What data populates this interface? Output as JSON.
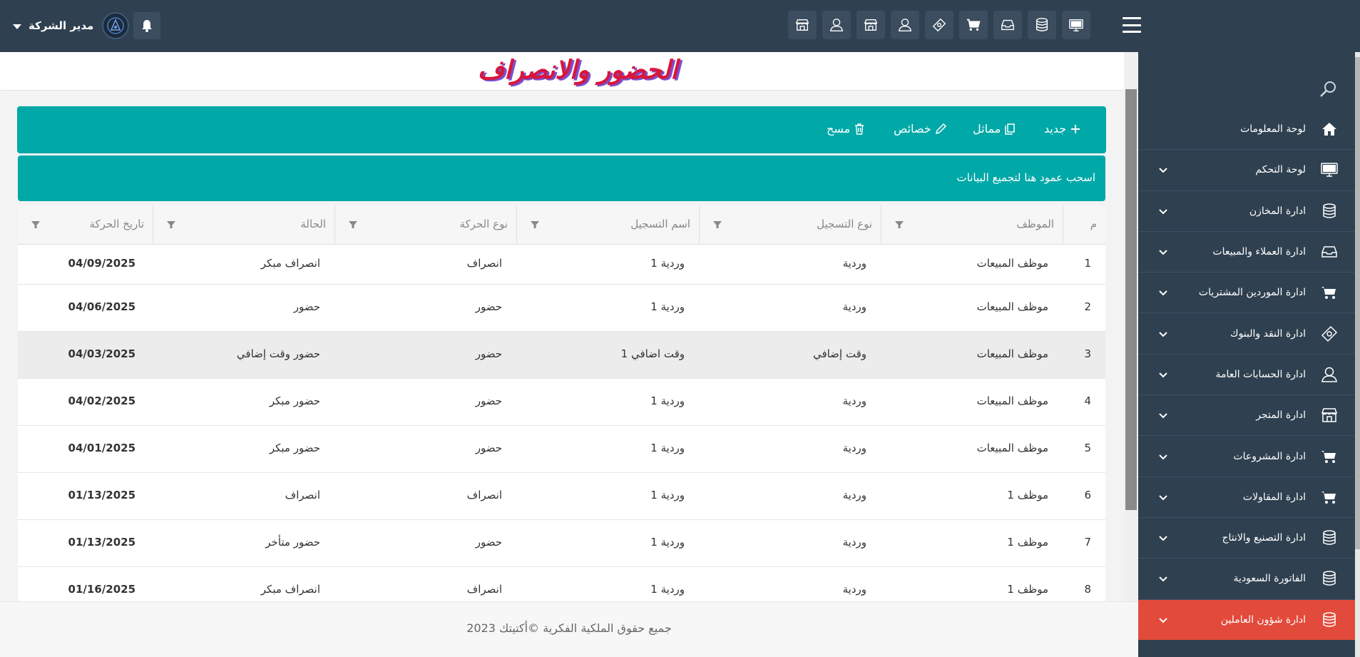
{
  "header": {
    "user_name": "مدير الشركة",
    "top_icons": [
      "store-icon",
      "user-icon",
      "store-icon",
      "user-icon",
      "money-icon",
      "cart-icon",
      "inbox-icon",
      "database-icon",
      "monitor-icon"
    ]
  },
  "page": {
    "title": "الحضور والانصراف"
  },
  "toolbar": {
    "new_label": "جديد",
    "similar_label": "مماثل",
    "properties_label": "خصائص",
    "delete_label": "مسح"
  },
  "grouping": {
    "hint": "اسحب عمود هنا لتجميع البيانات"
  },
  "table": {
    "columns": [
      "م",
      "الموظف",
      "نوع التسجيل",
      "اسم التسجيل",
      "نوع الحركة",
      "الحالة",
      "تاريخ الحركة"
    ],
    "rows": [
      [
        "1",
        "موظف المبيعات",
        "وردية",
        "وردية 1",
        "انصراف",
        "انصراف مبكر",
        "04/09/2025"
      ],
      [
        "2",
        "موظف المبيعات",
        "وردية",
        "وردية 1",
        "حضور",
        "حضور",
        "04/06/2025"
      ],
      [
        "3",
        "موظف المبيعات",
        "وقت إضافي",
        "وقت اضافي 1",
        "حضور",
        "حضور وقت إضافي",
        "04/03/2025"
      ],
      [
        "4",
        "موظف المبيعات",
        "وردية",
        "وردية 1",
        "حضور",
        "حضور مبكر",
        "04/02/2025"
      ],
      [
        "5",
        "موظف المبيعات",
        "وردية",
        "وردية 1",
        "حضور",
        "حضور مبكر",
        "04/01/2025"
      ],
      [
        "6",
        "موظف 1",
        "وردية",
        "وردية 1",
        "انصراف",
        "انصراف",
        "01/13/2025"
      ],
      [
        "7",
        "موظف 1",
        "وردية",
        "وردية 1",
        "حضور",
        "حضور متأخر",
        "01/13/2025"
      ],
      [
        "8",
        "موظف 1",
        "وردية",
        "وردية 1",
        "انصراف",
        "انصراف مبكر",
        "01/16/2025"
      ]
    ]
  },
  "sidebar": {
    "items": [
      {
        "label": "لوحة المعلومات",
        "icon": "home-icon"
      },
      {
        "label": "لوحة التحكم",
        "icon": "monitor-icon"
      },
      {
        "label": "ادارة المخازن",
        "icon": "database-icon"
      },
      {
        "label": "ادارة العملاء والمبيعات",
        "icon": "inbox-icon"
      },
      {
        "label": "ادارة الموردين المشتريات",
        "icon": "cart-icon"
      },
      {
        "label": "ادارة النقد والبنوك",
        "icon": "money-icon"
      },
      {
        "label": "ادارة الحسابات العامة",
        "icon": "user-icon"
      },
      {
        "label": "ادارة المتجر",
        "icon": "store-icon"
      },
      {
        "label": "ادارة المشروعات",
        "icon": "cart-icon"
      },
      {
        "label": "ادارة المقاولات",
        "icon": "cart-icon"
      },
      {
        "label": "ادارة التصنيع والانتاج",
        "icon": "database-icon"
      },
      {
        "label": "الفاتورة السعودية",
        "icon": "database-icon"
      },
      {
        "label": "ادارة شؤون العاملين",
        "icon": "database-icon"
      }
    ]
  },
  "footer": {
    "copyright": "جميع حقوق الملكية الفكرية ©أكتيتك 2023"
  },
  "colors": {
    "topbar": "#2f4050",
    "accent": "#00a8a8",
    "active_menu": "#e24a3b",
    "title_red": "#d9163a",
    "title_shadow": "#7a4fd0"
  }
}
